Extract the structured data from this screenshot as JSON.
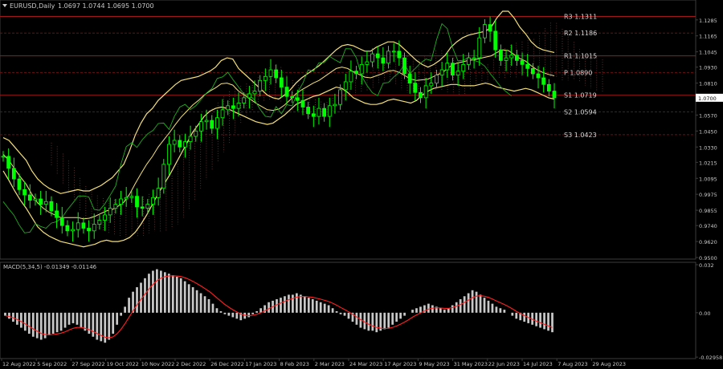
{
  "header": {
    "symbol": "EURUSD,Daily",
    "ohlc": "1.0697 1.0744 1.0695 1.0700"
  },
  "macd_header": "MACD(5,34,5) -0.01349 -0.01146",
  "colors": {
    "bg": "#000000",
    "grid": "#0c0c0c",
    "axis": "#3c3c3c",
    "text": "#c8c8c8",
    "candle": "#00ff00",
    "bb": "#f5e07a",
    "pivot": "#9a1a1a",
    "macd_hist": "#c8c8c8",
    "macd_signal": "#ff2020",
    "chikou": "#1fae1f",
    "kumo": "#d07070"
  },
  "chart_data": [
    {
      "type": "line",
      "title": "EURUSD,Daily",
      "ylim": [
        0.95,
        1.135
      ],
      "y_ticks": [
        "1.1285",
        "1.1165",
        "1.1045",
        "1.0930",
        "1.0810",
        "1.0690",
        "1.0570",
        "1.0450",
        "1.0330",
        "1.0215",
        "1.0095",
        "0.9975",
        "0.9855",
        "0.9740",
        "0.9620",
        "0.9500"
      ],
      "x_ticks": [
        "12 Aug 2022",
        "5 Sep 2022",
        "27 Sep 2022",
        "19 Oct 2022",
        "10 Nov 2022",
        "2 Dec 2022",
        "26 Dec 2022",
        "17 Jan 2023",
        "8 Feb 2023",
        "2 Mar 2023",
        "24 Mar 2023",
        "17 Apr 2023",
        "9 May 2023",
        "31 May 2023",
        "22 Jun 2023",
        "14 Jul 2023",
        "7 Aug 2023",
        "29 Aug 2023"
      ],
      "last_price": "1.0700",
      "pivot_levels": [
        {
          "name": "R3",
          "label": "R3 1.1311",
          "value": 1.1311
        },
        {
          "name": "R2",
          "label": "R2 1.1186",
          "value": 1.1186
        },
        {
          "name": "R1",
          "label": "R1 1.1015",
          "value": 1.1015
        },
        {
          "name": "P",
          "label": "P 1.0890",
          "value": 1.089
        },
        {
          "name": "S1",
          "label": "S1 1.0719",
          "value": 1.0719
        },
        {
          "name": "S2",
          "label": "S2 1.0594",
          "value": 1.0594
        },
        {
          "name": "S3",
          "label": "S3 1.0423",
          "value": 1.0423
        }
      ],
      "series": [
        {
          "name": "close",
          "step_days": 2,
          "values": [
            1.026,
            1.017,
            1.009,
            1.001,
            0.997,
            0.993,
            0.994,
            0.99,
            0.992,
            0.985,
            0.98,
            0.974,
            0.97,
            0.971,
            0.976,
            0.972,
            0.97,
            0.975,
            0.978,
            0.982,
            0.987,
            0.99,
            0.994,
            0.995,
            0.996,
            0.988,
            0.987,
            0.99,
            0.995,
            1.002,
            1.02,
            1.035,
            1.038,
            1.033,
            1.037,
            1.041,
            1.045,
            1.052,
            1.053,
            1.047,
            1.055,
            1.061,
            1.064,
            1.062,
            1.066,
            1.07,
            1.073,
            1.075,
            1.083,
            1.086,
            1.091,
            1.085,
            1.078,
            1.071,
            1.07,
            1.068,
            1.063,
            1.058,
            1.056,
            1.062,
            1.056,
            1.064,
            1.065,
            1.076,
            1.082,
            1.09,
            1.088,
            1.095,
            1.097,
            1.103,
            1.1,
            1.096,
            1.105,
            1.105,
            1.1,
            1.088,
            1.081,
            1.074,
            1.07,
            1.079,
            1.081,
            1.087,
            1.091,
            1.096,
            1.087,
            1.09,
            1.095,
            1.1,
            1.1,
            1.115,
            1.125,
            1.12,
            1.106,
            1.098,
            1.1,
            1.102,
            1.098,
            1.095,
            1.092,
            1.088,
            1.085,
            1.08,
            1.075,
            1.07
          ]
        },
        {
          "name": "upper_band",
          "step_days": 2,
          "values": [
            1.04,
            1.038,
            1.033,
            1.028,
            1.023,
            1.015,
            1.009,
            1.005,
            1.002,
            1.0,
            0.998,
            0.999,
            1.0,
            1.001,
            1.0,
            1.0,
            1.002,
            1.004,
            1.007,
            1.01,
            1.015,
            1.02,
            1.03,
            1.042,
            1.051,
            1.058,
            1.062,
            1.068,
            1.072,
            1.076,
            1.08,
            1.083,
            1.084,
            1.085,
            1.086,
            1.088,
            1.09,
            1.093,
            1.098,
            1.1,
            1.099,
            1.092,
            1.088,
            1.084,
            1.08,
            1.076,
            1.072,
            1.07,
            1.069,
            1.072,
            1.076,
            1.081,
            1.085,
            1.088,
            1.091,
            1.094,
            1.098,
            1.102,
            1.106,
            1.109,
            1.11,
            1.109,
            1.107,
            1.105,
            1.105,
            1.108,
            1.11,
            1.112,
            1.112,
            1.11,
            1.106,
            1.102,
            1.098,
            1.095,
            1.093,
            1.095,
            1.098,
            1.102,
            1.108,
            1.112,
            1.115,
            1.117,
            1.118,
            1.119,
            1.12,
            1.123,
            1.13,
            1.135,
            1.135,
            1.13,
            1.123,
            1.118,
            1.112,
            1.108,
            1.106,
            1.105,
            1.104
          ]
        },
        {
          "name": "lower_band",
          "step_days": 2,
          "values": [
            1.015,
            1.008,
            1.0,
            0.993,
            0.987,
            0.98,
            0.973,
            0.969,
            0.966,
            0.964,
            0.962,
            0.961,
            0.96,
            0.959,
            0.958,
            0.959,
            0.96,
            0.962,
            0.963,
            0.962,
            0.962,
            0.963,
            0.965,
            0.969,
            0.975,
            0.982,
            0.99,
            0.998,
            1.005,
            1.012,
            1.02,
            1.028,
            1.036,
            1.044,
            1.05,
            1.056,
            1.06,
            1.062,
            1.063,
            1.062,
            1.06,
            1.058,
            1.056,
            1.054,
            1.052,
            1.051,
            1.05,
            1.051,
            1.054,
            1.057,
            1.061,
            1.065,
            1.067,
            1.069,
            1.071,
            1.072,
            1.074,
            1.076,
            1.078,
            1.077,
            1.074,
            1.07,
            1.068,
            1.066,
            1.065,
            1.065,
            1.066,
            1.068,
            1.069,
            1.068,
            1.067,
            1.066,
            1.068,
            1.072,
            1.075,
            1.077,
            1.078,
            1.079,
            1.08,
            1.08,
            1.079,
            1.079,
            1.079,
            1.08,
            1.081,
            1.08,
            1.078,
            1.077,
            1.076,
            1.075,
            1.076,
            1.077,
            1.076,
            1.074,
            1.072,
            1.07,
            1.069
          ]
        }
      ]
    },
    {
      "type": "bar",
      "title": "MACD(5,34,5) -0.01349 -0.01146",
      "ylim": [
        -0.0295,
        0.032
      ],
      "y_ticks": [
        "0.032",
        "0.00",
        "-0.02958"
      ],
      "series": [
        {
          "name": "histogram",
          "step_days": 2,
          "values": [
            -0.002,
            -0.004,
            -0.006,
            -0.008,
            -0.01,
            -0.012,
            -0.014,
            -0.016,
            -0.017,
            -0.018,
            -0.017,
            -0.015,
            -0.014,
            -0.013,
            -0.012,
            -0.01,
            -0.008,
            -0.007,
            -0.008,
            -0.01,
            -0.012,
            -0.014,
            -0.016,
            -0.018,
            -0.019,
            -0.02,
            -0.018,
            -0.014,
            -0.008,
            -0.002,
            0.004,
            0.01,
            0.014,
            0.017,
            0.02,
            0.023,
            0.026,
            0.028,
            0.029,
            0.028,
            0.027,
            0.026,
            0.025,
            0.024,
            0.023,
            0.021,
            0.019,
            0.017,
            0.015,
            0.013,
            0.011,
            0.009,
            0.006,
            0.003,
            0.001,
            -0.001,
            -0.002,
            -0.003,
            -0.004,
            -0.005,
            -0.004,
            -0.003,
            -0.001,
            0.001,
            0.003,
            0.005,
            0.007,
            0.008,
            0.009,
            0.01,
            0.011,
            0.012,
            0.012,
            0.013,
            0.012,
            0.011,
            0.01,
            0.009,
            0.008,
            0.007,
            0.006,
            0.005,
            0.003,
            0.001,
            -0.001,
            -0.002,
            -0.004,
            -0.006,
            -0.008,
            -0.01,
            -0.011,
            -0.012,
            -0.012,
            -0.013,
            -0.012,
            -0.011,
            -0.01,
            -0.008,
            -0.006,
            -0.004,
            -0.002,
            0.0,
            0.002,
            0.003,
            0.004,
            0.005,
            0.006,
            0.005,
            0.004,
            0.003,
            0.002,
            0.003,
            0.005,
            0.007,
            0.009,
            0.011,
            0.013,
            0.015,
            0.014,
            0.012,
            0.01,
            0.008,
            0.006,
            0.004,
            0.003,
            0.002,
            0.0,
            -0.002,
            -0.004,
            -0.005,
            -0.006,
            -0.007,
            -0.008,
            -0.009,
            -0.01,
            -0.011,
            -0.012,
            -0.013
          ]
        }
      ]
    }
  ]
}
